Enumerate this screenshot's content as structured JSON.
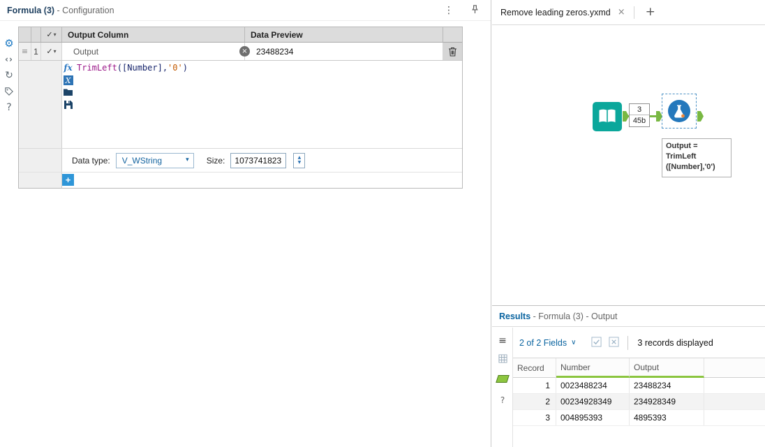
{
  "icons": {
    "menu": "⋮",
    "gear": "⚙",
    "code": "‹›",
    "refresh": "↻",
    "grip": "≡",
    "check": "✓",
    "caret": "▾",
    "clear": "×",
    "dropdown_caret": "▾",
    "spinner_up": "▲",
    "spinner_down": "▼",
    "chevron_down": "∨",
    "list": "≡",
    "question": "?"
  },
  "config_panel": {
    "title": "Formula (3)",
    "title_suffix": " - Configuration",
    "grid": {
      "header_output": "Output Column",
      "header_preview": "Data Preview",
      "row_number": "1",
      "output_name": "Output",
      "data_preview": "23488234"
    },
    "formula_toolbar": {
      "fx": "fx",
      "x": "X"
    },
    "formula": {
      "function": "TrimLeft",
      "open": "([Number],",
      "string": "'0'",
      "close": ")"
    },
    "data_type_label": "Data type:",
    "data_type_value": "V_WString",
    "size_label": "Size:",
    "size_value": "1073741823",
    "add_button": "+"
  },
  "canvas_panel": {
    "tab_title": "Remove leading zeros.yxmd",
    "tab_close": "×",
    "new_tab": "+",
    "connection_badge": {
      "count": "3",
      "size": "45b"
    },
    "annotation": {
      "line1": "Output =",
      "line2": "TrimLeft",
      "line3": "([Number],'0')"
    }
  },
  "results_panel": {
    "title": "Results",
    "title_suffix": " - Formula (3) - Output",
    "fields_summary": "2 of 2 Fields",
    "records_summary": "3 records displayed",
    "table": {
      "headers": [
        "Record",
        "Number",
        "Output"
      ],
      "rows": [
        [
          "1",
          "0023488234",
          "23488234"
        ],
        [
          "2",
          "00234928349",
          "234928349"
        ],
        [
          "3",
          "004895393",
          "4895393"
        ]
      ]
    }
  },
  "colors": {
    "accent_blue": "#0a64a0",
    "tool_teal": "#0ba79b",
    "tool_blue": "#2478bc",
    "connector_green": "#79b843",
    "results_green": "#8bc53f"
  }
}
